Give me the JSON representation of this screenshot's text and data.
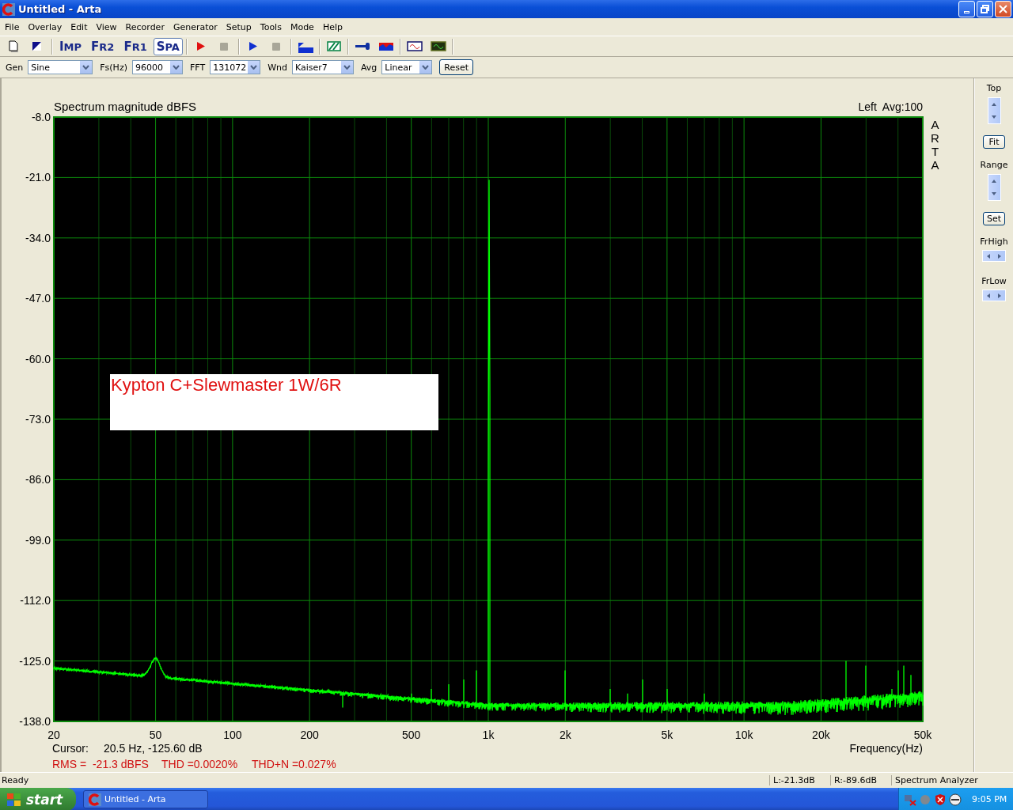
{
  "window": {
    "title": "Untitled - Arta"
  },
  "menu": [
    "File",
    "Overlay",
    "Edit",
    "View",
    "Recorder",
    "Generator",
    "Setup",
    "Tools",
    "Mode",
    "Help"
  ],
  "mode_buttons": [
    {
      "label": "IMP",
      "selected": false
    },
    {
      "label": "FR2",
      "selected": false
    },
    {
      "label": "FR1",
      "selected": false
    },
    {
      "label": "SPA",
      "selected": true
    }
  ],
  "settings": [
    {
      "label": "Gen",
      "value": "Sine"
    },
    {
      "label": "Fs(Hz)",
      "value": "96000"
    },
    {
      "label": "FFT",
      "value": "131072"
    },
    {
      "label": "Wnd",
      "value": "Kaiser7"
    },
    {
      "label": "Avg",
      "value": "Linear"
    }
  ],
  "reset_button": "Reset",
  "plot": {
    "title": "Spectrum magnitude dBFS",
    "channel_info": "Left  Avg:100",
    "brand": "ARTA",
    "y_labels": [
      "-8.0",
      "-21.0",
      "-34.0",
      "-47.0",
      "-60.0",
      "-73.0",
      "-86.0",
      "-99.0",
      "-112.0",
      "-125.0",
      "-138.0"
    ],
    "x_labels": [
      "20",
      "50",
      "100",
      "200",
      "500",
      "1k",
      "2k",
      "5k",
      "10k",
      "20k",
      "50k"
    ],
    "x_title": "Frequency(Hz)",
    "annotation": "Kypton C+Slewmaster 1W/6R",
    "cursor_label": "Cursor:",
    "cursor_value": "20.5 Hz, -125.60 dB",
    "measurements": [
      "RMS =  -21.3 dBFS",
      "THD =0.0020%",
      "THD+N =0.027%"
    ]
  },
  "side_panel": {
    "top_label": "Top",
    "fit_button": "Fit",
    "range_label": "Range",
    "set_button": "Set",
    "frhigh_label": "FrHigh",
    "frlow_label": "FrLow"
  },
  "status_bar": [
    "Ready",
    "L:-21.3dB",
    "R:-89.6dB",
    "Spectrum Analyzer"
  ],
  "taskbar": {
    "start": "start",
    "task": "Untitled - Arta",
    "clock": "9:05 PM"
  }
}
